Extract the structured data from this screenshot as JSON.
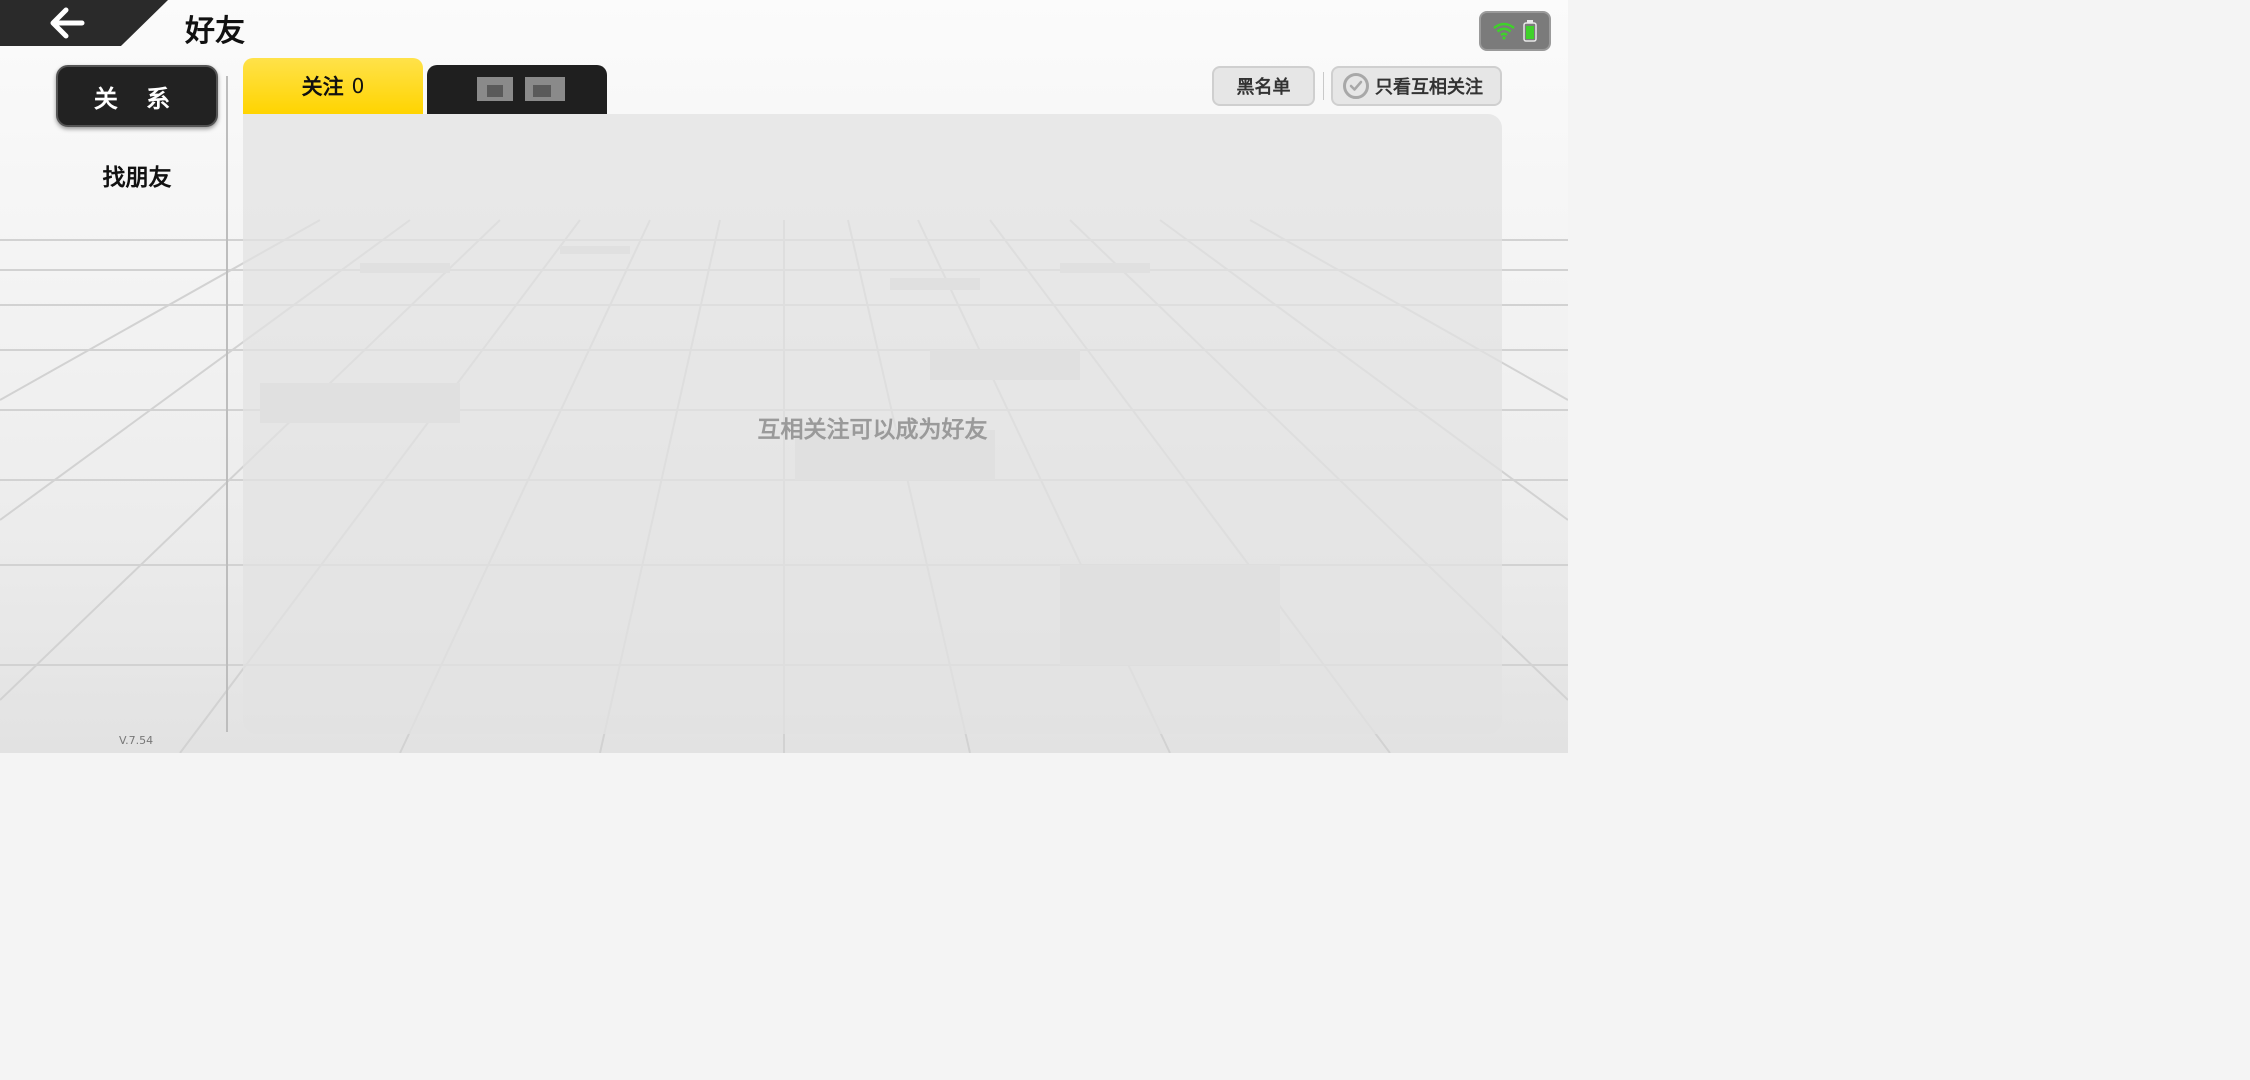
{
  "header": {
    "title": "好友"
  },
  "nav": {
    "items": [
      {
        "label": "关 系",
        "active": true
      },
      {
        "label": "找朋友",
        "active": false
      }
    ]
  },
  "tabs": {
    "follow": {
      "label": "关注",
      "count": "0"
    }
  },
  "toolbar": {
    "blacklist_label": "黑名单",
    "mutual_only_label": "只看互相关注"
  },
  "content": {
    "empty_message": "互相关注可以成为好友"
  },
  "footer": {
    "version": "V.7.54"
  },
  "colors": {
    "accent": "#ffd400",
    "dark": "#222222",
    "wifi": "#3fd12a",
    "battery": "#3fd12a"
  }
}
